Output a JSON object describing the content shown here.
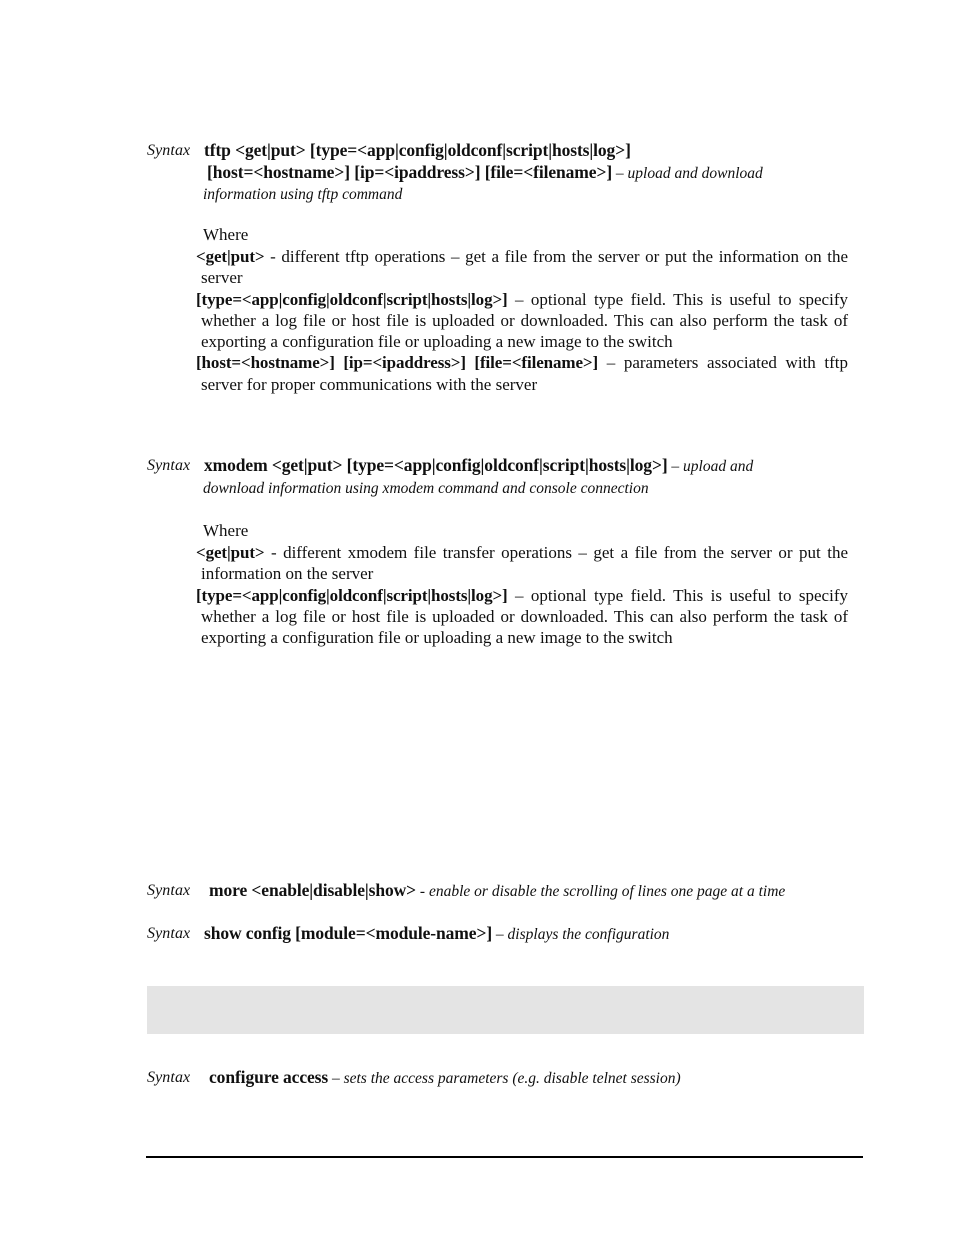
{
  "document": {
    "type": "cli-command-reference-page",
    "background_color": "#ffffff",
    "text_color": "#101010"
  },
  "syntax_entries": [
    {
      "id": "tftp",
      "label": "Syntax",
      "command_line1": "tftp <get|put> [type=<app|config|oldconf|script|hosts|log>]",
      "command_line2": "[host=<hostname>] [ip=<ipaddress>] [file=<filename>]",
      "dash": " – ",
      "description_line1": "upload and download",
      "description_line2": "information using tftp command"
    },
    {
      "id": "xmodem",
      "label": "Syntax",
      "command_line1": "xmodem <get|put> [type=<app|config|oldconf|script|hosts|log>]",
      "dash": " – ",
      "description_line1": "upload and",
      "description_line2": "download information using xmodem command and console connection"
    },
    {
      "id": "more",
      "label": "Syntax",
      "command_line1": "more <enable|disable|show>",
      "dash": " - ",
      "description_line1": "enable or disable the scrolling of lines one page at a time"
    },
    {
      "id": "show-config",
      "label": "Syntax",
      "command_line1": "show config [module=<module-name>]",
      "dash": " – ",
      "description_line1": "displays the configuration"
    },
    {
      "id": "configure-access",
      "label": "Syntax",
      "command_line1": "configure access",
      "dash": " – ",
      "description_line1": "sets the access parameters (e.g. disable telnet session)"
    }
  ],
  "tftp_where": {
    "heading": "Where",
    "definitions": [
      {
        "term": "<get|put>",
        "body": " - different tftp operations – get a file from the server or put the information on the server"
      },
      {
        "term": "[type=<app|config|oldconf|script|hosts|log>]",
        "body": " – optional type field. This is useful to specify whether a log file or host file is uploaded or downloaded. This can also perform the task of exporting a configuration file or uploading a new image to the switch"
      },
      {
        "term": "[host=<hostname>] [ip=<ipaddress>] [file=<filename>]",
        "body": " – parameters associated with tftp server for proper communications with the server"
      }
    ]
  },
  "xmodem_where": {
    "heading": "Where",
    "definitions": [
      {
        "term": "<get|put>",
        "body": " - different xmodem file transfer operations – get a file from the server or put the information on the server"
      },
      {
        "term": "[type=<app|config|oldconf|script|hosts|log>]",
        "body": " – optional type field. This is useful to specify whether a log file or host file is uploaded or downloaded. This can also perform the task of exporting a configuration file or uploading a new image to the switch"
      }
    ]
  },
  "placeholder_box": {
    "fill_color": "#e4e4e4",
    "content": ""
  },
  "footer_rule": {
    "color": "#000000"
  }
}
